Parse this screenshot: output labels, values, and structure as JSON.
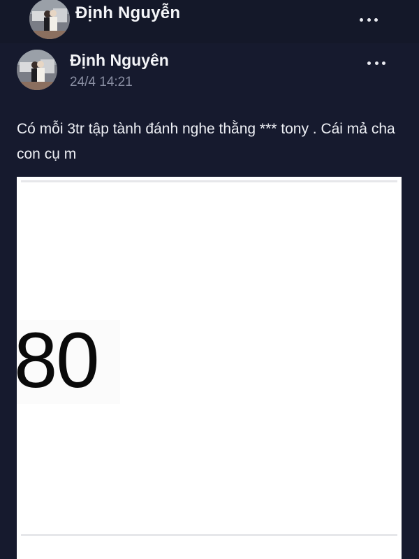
{
  "top_header": {
    "name": "Định Nguyễn",
    "avatar_icon": "profile-photo-avatar",
    "menu_icon": "more-dots-icon"
  },
  "post": {
    "author": "Định Nguyên",
    "timestamp": "24/4 14:21",
    "text": "Có mỗi 3tr tập tành đánh nghe thằng *** tony . Cái mả cha con cụ m",
    "avatar_icon": "profile-photo-avatar",
    "menu_icon": "more-dots-icon",
    "image": {
      "number_text": "80"
    }
  },
  "colors": {
    "background": "#161a2e",
    "text_primary": "#f4f5f8",
    "text_secondary": "#8a8fa3"
  }
}
